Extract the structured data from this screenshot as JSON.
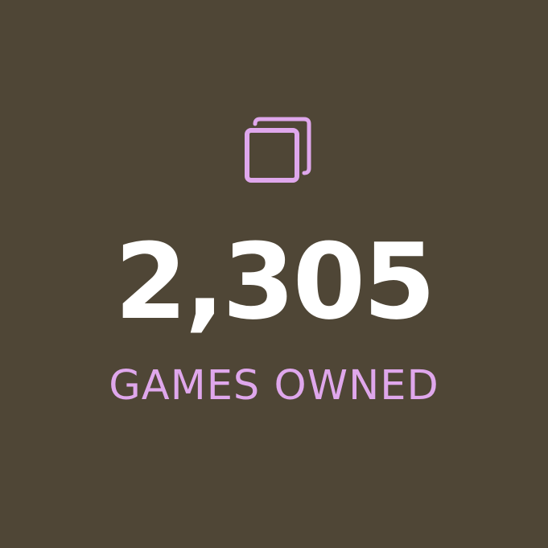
{
  "stat": {
    "value": "2,305",
    "label": "GAMES OWNED",
    "icon": "collection-icon"
  },
  "colors": {
    "background": "#4f4636",
    "accent": "#dfa7ec",
    "value_text": "#ffffff"
  }
}
